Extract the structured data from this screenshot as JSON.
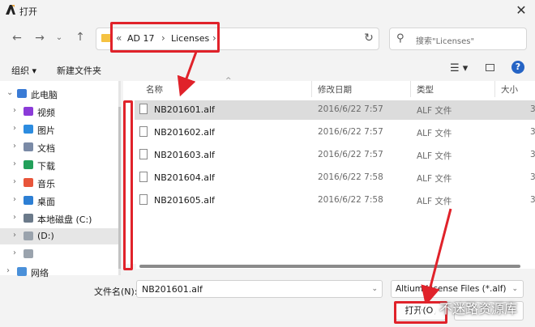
{
  "window": {
    "title": "打开"
  },
  "address": {
    "overflow": "«",
    "crumbs": [
      "AD 17",
      "Licenses"
    ],
    "search_placeholder": "搜索\"Licenses\""
  },
  "toolbar": {
    "organize": "组织 ▾",
    "new_folder": "新建文件夹"
  },
  "tree": [
    {
      "label": "此电脑",
      "icon": "computer-icon",
      "color": "#3a7bd5"
    },
    {
      "label": "视频",
      "icon": "video-icon",
      "color": "#8b3bd8"
    },
    {
      "label": "图片",
      "icon": "pictures-icon",
      "color": "#2c8ce0"
    },
    {
      "label": "文档",
      "icon": "documents-icon",
      "color": "#7a8aa6"
    },
    {
      "label": "下载",
      "icon": "download-icon",
      "color": "#22a05a"
    },
    {
      "label": "音乐",
      "icon": "music-icon",
      "color": "#e8553a"
    },
    {
      "label": "桌面",
      "icon": "desktop-icon",
      "color": "#2d7fd4"
    },
    {
      "label": "本地磁盘 (C:)",
      "icon": "drive-icon",
      "color": "#6b7a8a"
    },
    {
      "label": "(D:)",
      "icon": "drive-icon",
      "color": "#9aa3ad"
    },
    {
      "label": "",
      "icon": "drive-icon",
      "color": "#9aa3ad"
    },
    {
      "label": "网络",
      "icon": "network-icon",
      "color": "#4a90d9"
    }
  ],
  "columns": {
    "name": "名称",
    "date": "修改日期",
    "type": "类型",
    "size": "大小"
  },
  "files": [
    {
      "name": "NB201601.alf",
      "date": "2016/6/22 7:57",
      "type": "ALF 文件",
      "size": "3"
    },
    {
      "name": "NB201602.alf",
      "date": "2016/6/22 7:57",
      "type": "ALF 文件",
      "size": "3"
    },
    {
      "name": "NB201603.alf",
      "date": "2016/6/22 7:57",
      "type": "ALF 文件",
      "size": "3"
    },
    {
      "name": "NB201604.alf",
      "date": "2016/6/22 7:58",
      "type": "ALF 文件",
      "size": "3"
    },
    {
      "name": "NB201605.alf",
      "date": "2016/6/22 7:58",
      "type": "ALF 文件",
      "size": "3"
    }
  ],
  "bottom": {
    "filename_label": "文件名(N):",
    "filename_value": "NB201601.alf",
    "filetype": "Altium License Files (*.alf)",
    "open": "打开(O)"
  },
  "watermark": "不迷路资源库",
  "colors": {
    "annotation": "#e0222a",
    "selection": "#dcdcdc",
    "help": "#2564c5"
  }
}
